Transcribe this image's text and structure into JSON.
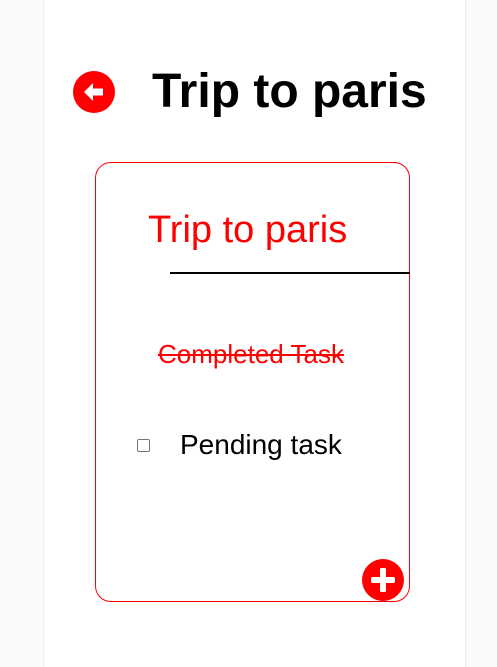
{
  "header": {
    "title": "Trip to paris",
    "back_icon": "arrow-left-circle-icon"
  },
  "list": {
    "title": "Trip to paris",
    "tasks": [
      {
        "label": "Completed Task",
        "completed": true
      },
      {
        "label": "Pending task",
        "completed": false
      }
    ],
    "add_icon": "plus-circle-icon"
  },
  "colors": {
    "accent": "#ff0000",
    "text": "#000000",
    "background": "#ffffff"
  }
}
